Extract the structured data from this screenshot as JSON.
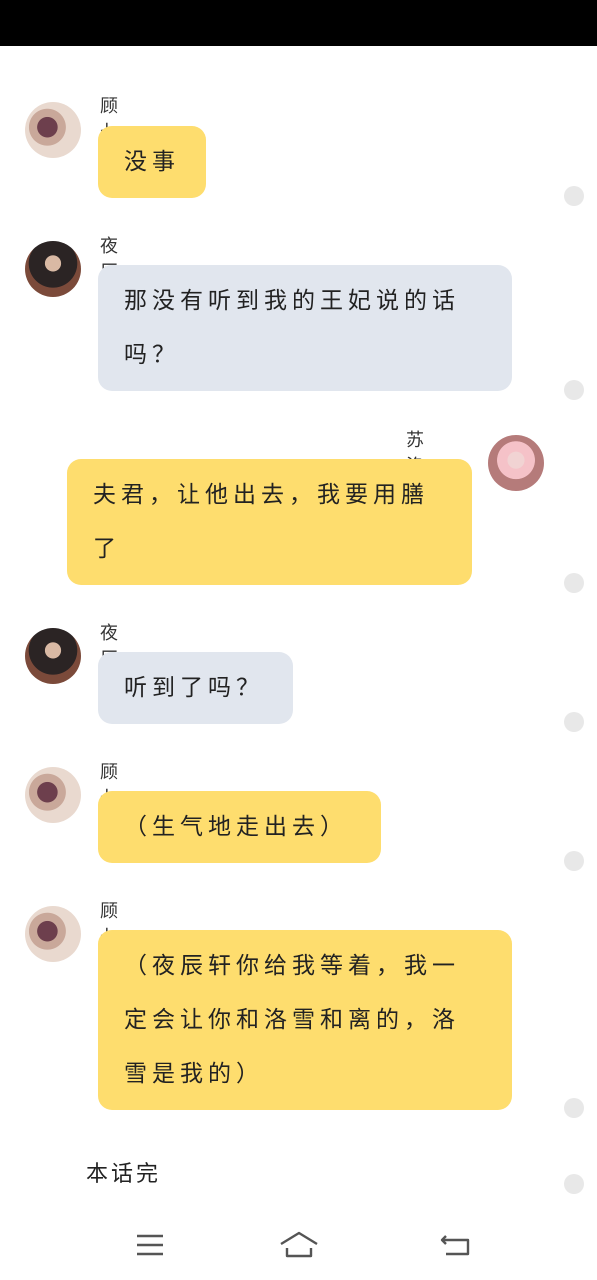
{
  "messages": [
    {
      "sender": "顾七少",
      "lines": [
        "没事"
      ],
      "color": "yellow"
    },
    {
      "sender": "夜辰轩",
      "lines": [
        "那没有听到我的王妃说的话",
        "吗？"
      ],
      "color": "gray"
    },
    {
      "sender": "苏洛雪",
      "lines": [
        "夫君，让他出去，我要用膳",
        "了"
      ],
      "color": "yellow"
    },
    {
      "sender": "夜辰轩",
      "lines": [
        "听到了吗？"
      ],
      "color": "gray"
    },
    {
      "sender": "顾七少",
      "lines": [
        "（生气地走出去）"
      ],
      "color": "yellow"
    },
    {
      "sender": "顾七少",
      "lines": [
        "（夜辰轩你给我等着，我一",
        "定会让你和洛雪和离的，洛",
        "雪是我的）"
      ],
      "color": "yellow"
    }
  ],
  "end_text": "本话完",
  "colors": {
    "yellow_bubble": "#fedd6e",
    "gray_bubble": "#e1e6ee"
  },
  "nav": {
    "menu_icon": "menu-icon",
    "home_icon": "home-icon",
    "back_icon": "back-icon"
  }
}
